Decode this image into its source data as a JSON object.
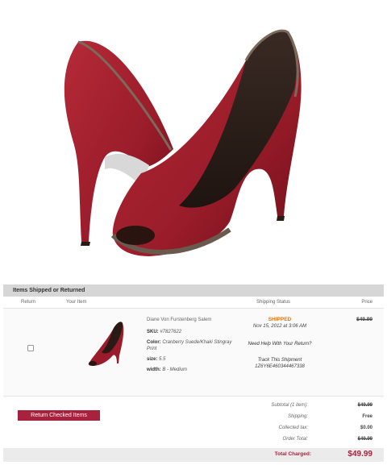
{
  "section_title": "Items Shipped or Returned",
  "columns": {
    "return": "Return",
    "your_item": "Your Item",
    "shipping_status": "Shipping Status",
    "price": "Price"
  },
  "item": {
    "brand": "Diane Von Furstenberg Salem",
    "sku_label": "SKU:",
    "sku": "#7827622",
    "color_label": "Color:",
    "color": "Cranberry Suede/Khaki Stingray Print",
    "size_label": "size:",
    "size": "5.5",
    "width_label": "width:",
    "width": "B - Medium",
    "status": "SHIPPED",
    "status_date": "Nov 15, 2012 at 3:06 AM",
    "help_link": "Need Help With Your Return?",
    "track_link": "Track This Shipment",
    "tracking_number": "1Z6Y6E460344467338",
    "price": "$49.99",
    "return_checked": false
  },
  "actions": {
    "return_button": "Return Checked Items"
  },
  "summary": {
    "subtotal_label": "Subtotal (1 item):",
    "subtotal": "$49.99",
    "shipping_label": "Shipping:",
    "shipping": "Free",
    "tax_label": "Collected tax:",
    "tax": "$0.00",
    "order_total_label": "Order Total:",
    "order_total": "$49.99",
    "total_charged_label": "Total Charged:",
    "total_charged": "$49.99"
  },
  "colors": {
    "accent": "#a8213d",
    "shipped": "#e8720c",
    "shoe_suede": "#a0202e",
    "header_band": "#d6d6d6"
  }
}
